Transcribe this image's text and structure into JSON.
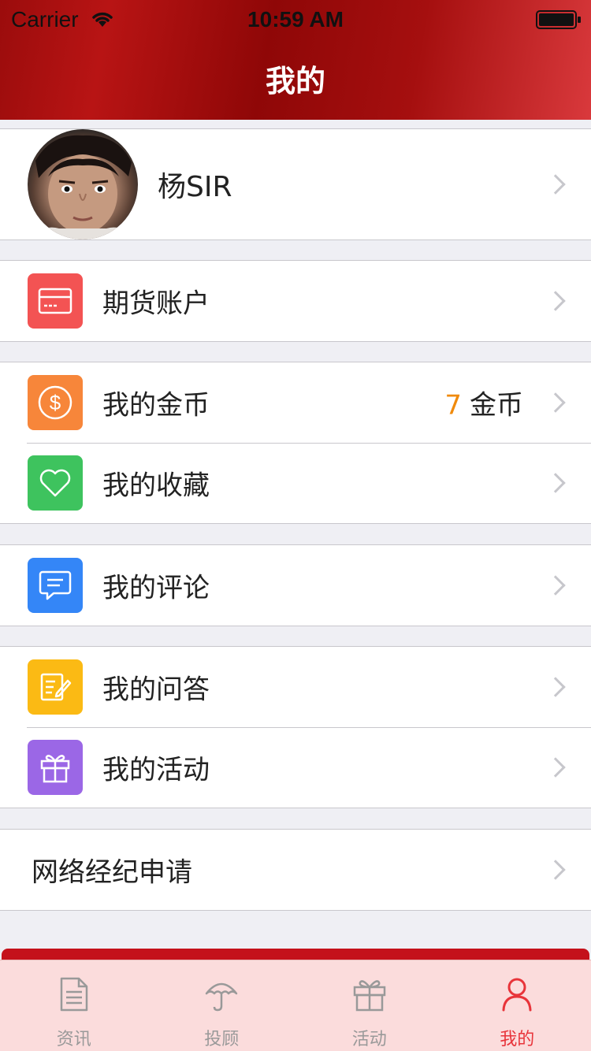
{
  "status": {
    "carrier": "Carrier",
    "time": "10:59 AM"
  },
  "nav": {
    "title": "我的"
  },
  "profile": {
    "name": "杨SIR"
  },
  "menu": {
    "futures_account": "期货账户",
    "my_coins": "我的金币",
    "coins_value": "7",
    "coins_unit": "金币",
    "my_favorites": "我的收藏",
    "my_comments": "我的评论",
    "my_qa": "我的问答",
    "my_activities": "我的活动",
    "broker_apply": "网络经纪申请"
  },
  "tabs": [
    {
      "label": "资讯",
      "icon": "document-icon",
      "active": false
    },
    {
      "label": "投顾",
      "icon": "umbrella-icon",
      "active": false
    },
    {
      "label": "活动",
      "icon": "gift-icon",
      "active": false
    },
    {
      "label": "我的",
      "icon": "person-icon",
      "active": true
    }
  ],
  "colors": {
    "header": "#b81414",
    "accent": "#e8343a",
    "coins_number": "#f08a0c",
    "icon_futures": "#f35353",
    "icon_coins": "#f7863a",
    "icon_favorites": "#3ec35e",
    "icon_comments": "#3486f7",
    "icon_qa": "#fbba14",
    "icon_activities": "#9b67e6"
  }
}
